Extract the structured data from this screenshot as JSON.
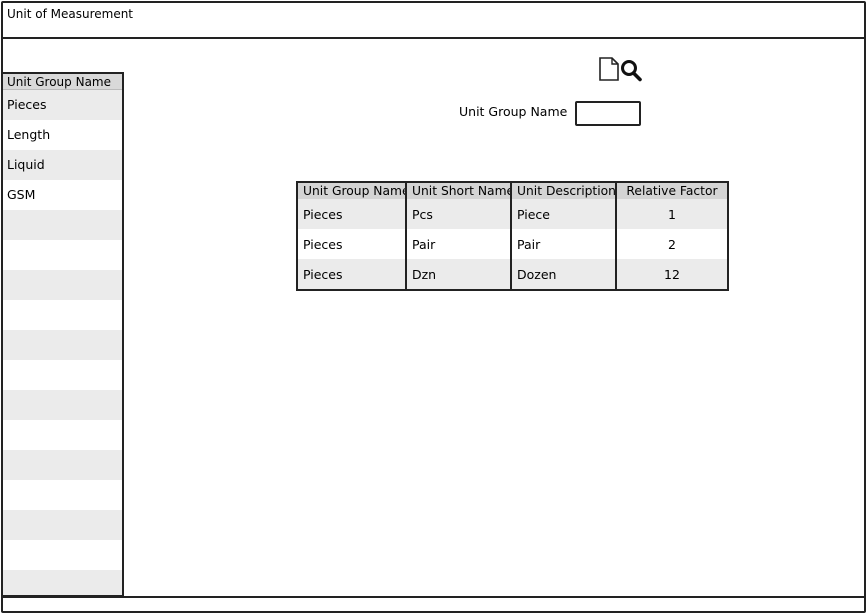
{
  "window": {
    "title": "Unit of Measurement"
  },
  "left_list": {
    "header": "Unit Group Name",
    "items": [
      "Pieces",
      "Length",
      "Liquid",
      "GSM",
      "",
      "",
      "",
      "",
      "",
      "",
      "",
      "",
      "",
      "",
      "",
      "",
      ""
    ]
  },
  "search": {
    "label": "Unit Group Name",
    "value": "",
    "icon": "document-search-icon"
  },
  "table": {
    "columns": [
      "Unit Group Name",
      "Unit Short Name",
      "Unit Description",
      "Relative Factor"
    ],
    "rows": [
      [
        "Pieces",
        "Pcs",
        "Piece",
        "1"
      ],
      [
        "Pieces",
        "Pair",
        "Pair",
        "2"
      ],
      [
        "Pieces",
        "Dzn",
        "Dozen",
        "12"
      ]
    ]
  }
}
